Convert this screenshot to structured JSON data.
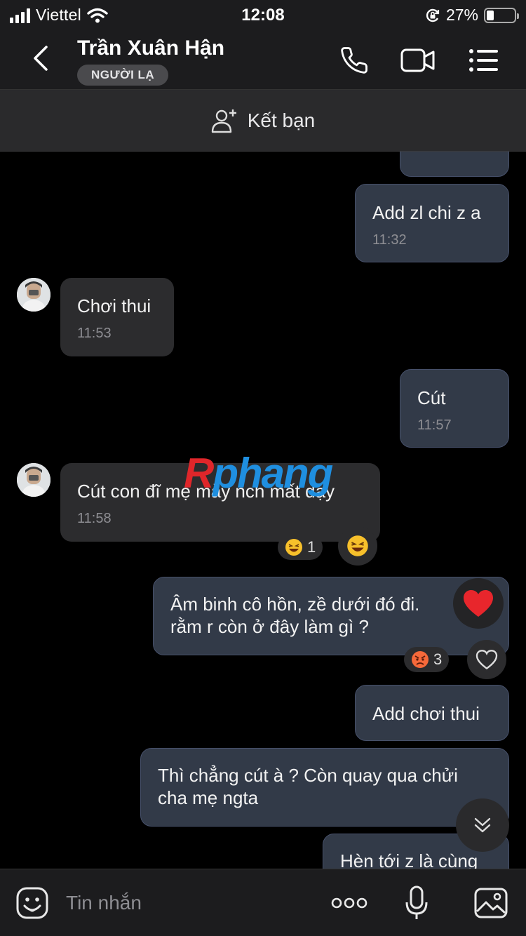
{
  "status_bar": {
    "carrier": "Viettel",
    "time": "12:08",
    "battery": "27%",
    "battery_level": 0.27
  },
  "header": {
    "contact_name": "Trần Xuân Hận",
    "badge": "NGƯỜI LẠ"
  },
  "add_friend": {
    "label": "Kết bạn"
  },
  "watermark": {
    "part1": "R",
    "part2": "phang"
  },
  "messages": [
    {
      "direction": "out",
      "text": "Add zl chi z a",
      "time": "11:32"
    },
    {
      "direction": "in",
      "text": "Chơi thui",
      "time": "11:53"
    },
    {
      "direction": "out",
      "text": "Cút",
      "time": "11:57"
    },
    {
      "direction": "in",
      "text": "Cút con đĩ mẹ mày nch mất dạy",
      "time": "11:58",
      "reaction": {
        "emoji": "laughing",
        "count": "1"
      }
    },
    {
      "direction": "out",
      "lines": [
        "Âm binh cô hồn, zề dưới đó đi. ",
        "rằm r còn ở đây làm gì ?"
      ],
      "reaction": {
        "emoji": "angry",
        "count": "3"
      }
    },
    {
      "direction": "out",
      "text": "Add chơi thui"
    },
    {
      "direction": "out",
      "lines": [
        "Thì chẳng cút à ? Còn quay qua chửi",
        "cha mẹ ngta"
      ]
    },
    {
      "direction": "out",
      "text": "Hèn tới z là cùng"
    }
  ],
  "input": {
    "placeholder": "Tin nhắn"
  },
  "colors": {
    "outgoing_bubble": "#323a48",
    "incoming_bubble": "#2c2c2e",
    "header": "#1c1c1e",
    "heart": "#e8262c"
  }
}
